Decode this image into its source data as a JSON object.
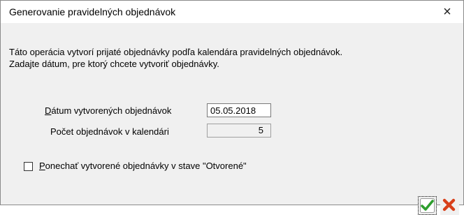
{
  "dialog": {
    "title": "Generovanie pravidelných objednávok",
    "close_glyph": "×",
    "description_line1": "Táto operácia vytvorí prijaté objednávky podľa kalendára pravidelných objednávok.",
    "description_line2": "Zadajte dátum, pre ktorý chcete vytvoriť objednávky."
  },
  "form": {
    "date_label_mnemonic": "D",
    "date_label_rest": "átum vytvorených objednávok",
    "date_value": "05.05.2018",
    "count_label": "Počet objednávok v kalendári",
    "count_value": "5",
    "checkbox_label_mnemonic": "P",
    "checkbox_label_rest": "onechať vytvorené objednávky v stave \"Otvorené\"",
    "checkbox_checked": false
  },
  "buttons": {
    "ok_icon": "green-check-icon",
    "cancel_icon": "red-x-icon"
  },
  "colors": {
    "ok_green": "#2e9e2e",
    "cancel_red": "#d8401a"
  }
}
